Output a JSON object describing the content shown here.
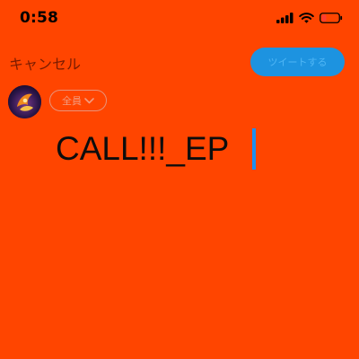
{
  "status_bar": {
    "time": "0:58",
    "icons": [
      "cellular-signal-icon",
      "wifi-icon",
      "battery-low-icon"
    ],
    "battery_color": "#ff3b30"
  },
  "compose": {
    "cancel_label": "キャンセル",
    "tweet_button_label": "ツイートする",
    "audience_label": "全員",
    "text": "CALL!!!_EP",
    "cursor_visible": true
  },
  "colors": {
    "background": "#ff4500",
    "accent": "#1d93e0",
    "audience_border": "#e8937a"
  }
}
